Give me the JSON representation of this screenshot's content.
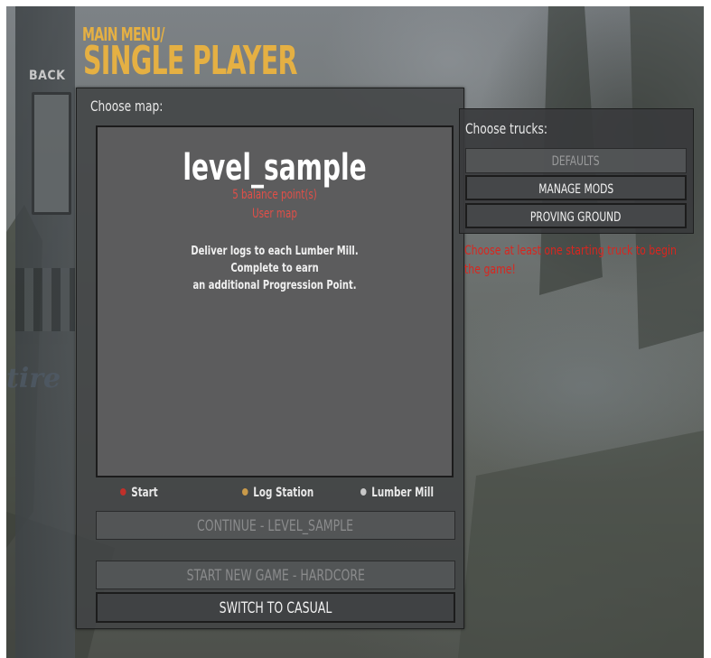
{
  "nav": {
    "back_label": "BACK",
    "breadcrumb": "MAIN MENU/",
    "title": "SINGLE PLAYER"
  },
  "map_panel": {
    "label": "Choose map:",
    "map_name": "level_sample",
    "balance_points": "5 balance point(s)",
    "map_type": "User map",
    "description_lines": [
      "Deliver logs to each Lumber Mill.",
      "Complete to earn",
      "an additional Progression Point."
    ]
  },
  "legend": {
    "items": [
      {
        "label": "Start",
        "color": "#c0302a"
      },
      {
        "label": "Log Station",
        "color": "#c99a4a"
      },
      {
        "label": "Lumber Mill",
        "color": "#c8c8c8"
      }
    ]
  },
  "buttons": {
    "continue_label": "CONTINUE - LEVEL_SAMPLE",
    "start_new_label": "START NEW GAME - HARDCORE",
    "switch_label": "SWITCH TO CASUAL"
  },
  "trucks": {
    "label": "Choose trucks:",
    "defaults_label": "DEFAULTS",
    "manage_mods_label": "MANAGE MODS",
    "proving_ground_label": "PROVING GROUND",
    "warning": "Choose at least one starting truck to begin the game!"
  },
  "background": {
    "side_text": "tire"
  },
  "colors": {
    "accent": "#e5b043",
    "warning": "#d8261f",
    "map_info": "#e04f48"
  }
}
